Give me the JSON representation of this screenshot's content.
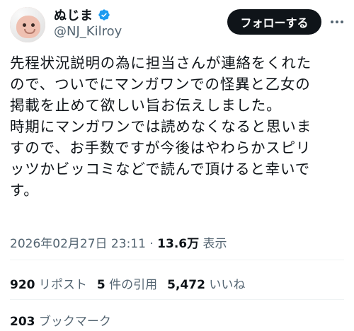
{
  "author": {
    "display_name": "ぬじま",
    "handle": "@NJ_Kilroy",
    "verified": true,
    "verified_color": "#1d9bf0",
    "avatar_icon": "avatar-blobfish"
  },
  "follow_button": {
    "label": "フォローする"
  },
  "more_icon": "more-options-icon",
  "post": {
    "lines": [
      "先程状況説明の為に担当さんが連絡をくれた",
      "ので、ついでにマンガワンでの怪異と乙女の",
      "掲載を止めて欲しい旨お伝えしました。",
      "時期にマンガワンでは読めなくなると思いま",
      "すので、お手数ですが今後はやわらかスピリ",
      "ッツかビッコミなどで読んで頂けると幸いで",
      "す。"
    ]
  },
  "meta": {
    "timestamp": "2026年02月27日 23:11",
    "separator": " · ",
    "views_count": "13.6万",
    "views_label": " 表示"
  },
  "stats": {
    "reposts_count": "920",
    "reposts_label": " リポスト",
    "quotes_count": "5",
    "quotes_label": " 件の引用",
    "likes_count": "5,472",
    "likes_label": " いいね"
  },
  "bookmarks": {
    "count": "203",
    "label": " ブックマーク"
  }
}
